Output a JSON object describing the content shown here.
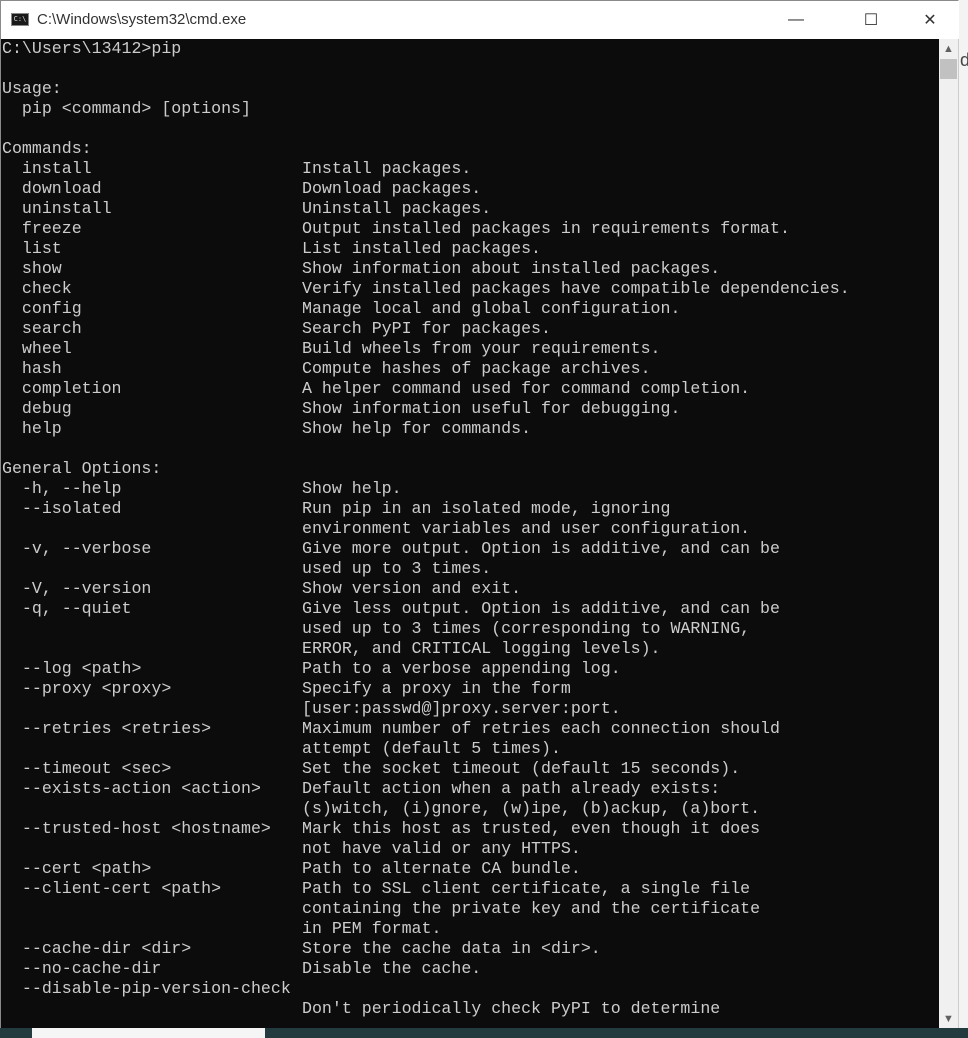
{
  "window": {
    "title": "C:\\Windows\\system32\\cmd.exe",
    "icon": "cmd-icon",
    "minimize": "—",
    "maximize": "☐",
    "close": "✕"
  },
  "background_text": "d",
  "console": {
    "lines": [
      "C:\\Users\\13412>pip",
      "",
      "Usage:",
      "  pip <command> [options]",
      "",
      "Commands:",
      [
        "  install",
        "Install packages."
      ],
      [
        "  download",
        "Download packages."
      ],
      [
        "  uninstall",
        "Uninstall packages."
      ],
      [
        "  freeze",
        "Output installed packages in requirements format."
      ],
      [
        "  list",
        "List installed packages."
      ],
      [
        "  show",
        "Show information about installed packages."
      ],
      [
        "  check",
        "Verify installed packages have compatible dependencies."
      ],
      [
        "  config",
        "Manage local and global configuration."
      ],
      [
        "  search",
        "Search PyPI for packages."
      ],
      [
        "  wheel",
        "Build wheels from your requirements."
      ],
      [
        "  hash",
        "Compute hashes of package archives."
      ],
      [
        "  completion",
        "A helper command used for command completion."
      ],
      [
        "  debug",
        "Show information useful for debugging."
      ],
      [
        "  help",
        "Show help for commands."
      ],
      "",
      "General Options:",
      [
        "  -h, --help",
        "Show help."
      ],
      [
        "  --isolated",
        "Run pip in an isolated mode, ignoring"
      ],
      [
        "",
        "environment variables and user configuration."
      ],
      [
        "  -v, --verbose",
        "Give more output. Option is additive, and can be"
      ],
      [
        "",
        "used up to 3 times."
      ],
      [
        "  -V, --version",
        "Show version and exit."
      ],
      [
        "  -q, --quiet",
        "Give less output. Option is additive, and can be"
      ],
      [
        "",
        "used up to 3 times (corresponding to WARNING,"
      ],
      [
        "",
        "ERROR, and CRITICAL logging levels)."
      ],
      [
        "  --log <path>",
        "Path to a verbose appending log."
      ],
      [
        "  --proxy <proxy>",
        "Specify a proxy in the form"
      ],
      [
        "",
        "[user:passwd@]proxy.server:port."
      ],
      [
        "  --retries <retries>",
        "Maximum number of retries each connection should"
      ],
      [
        "",
        "attempt (default 5 times)."
      ],
      [
        "  --timeout <sec>",
        "Set the socket timeout (default 15 seconds)."
      ],
      [
        "  --exists-action <action>",
        "Default action when a path already exists:"
      ],
      [
        "",
        "(s)witch, (i)gnore, (w)ipe, (b)ackup, (a)bort."
      ],
      [
        "  --trusted-host <hostname>",
        "Mark this host as trusted, even though it does"
      ],
      [
        "",
        "not have valid or any HTTPS."
      ],
      [
        "  --cert <path>",
        "Path to alternate CA bundle."
      ],
      [
        "  --client-cert <path>",
        "Path to SSL client certificate, a single file"
      ],
      [
        "",
        "containing the private key and the certificate"
      ],
      [
        "",
        "in PEM format."
      ],
      [
        "  --cache-dir <dir>",
        "Store the cache data in <dir>."
      ],
      [
        "  --no-cache-dir",
        "Disable the cache."
      ],
      "  --disable-pip-version-check",
      [
        "",
        "Don't periodically check PyPI to determine"
      ]
    ]
  }
}
